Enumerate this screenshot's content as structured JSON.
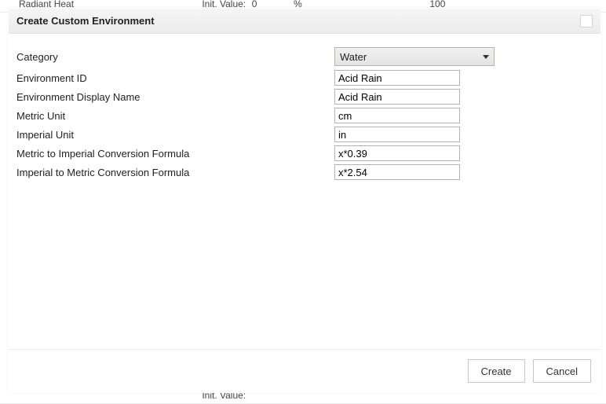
{
  "background": {
    "top_row": {
      "name": "Radiant Heat",
      "init_label": "Init. Value:",
      "init_value": "0",
      "unit": "%",
      "pct": "100"
    },
    "bottom_row": {
      "init_label": "Init. Value:"
    }
  },
  "dialog": {
    "title": "Create Custom Environment",
    "fields": {
      "category_label": "Category",
      "category_value": "Water",
      "env_id_label": "Environment ID",
      "env_id_value": "Acid Rain",
      "env_display_label": "Environment Display Name",
      "env_display_value": "Acid Rain",
      "metric_unit_label": "Metric Unit",
      "metric_unit_value": "cm",
      "imperial_unit_label": "Imperial Unit",
      "imperial_unit_value": "in",
      "m2i_label": "Metric to Imperial Conversion Formula",
      "m2i_value": "x*0.39",
      "i2m_label": "Imperial to Metric Conversion Formula",
      "i2m_value": "x*2.54"
    },
    "buttons": {
      "create": "Create",
      "cancel": "Cancel"
    }
  }
}
